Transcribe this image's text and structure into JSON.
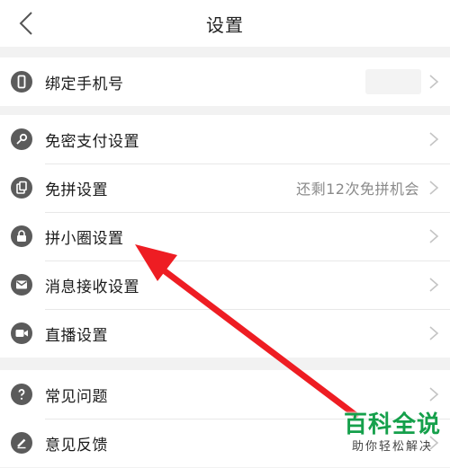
{
  "header": {
    "title": "设置"
  },
  "groups": [
    [
      {
        "label": "绑定手机号",
        "icon": "phone-icon"
      }
    ],
    [
      {
        "label": "免密支付设置",
        "icon": "key-icon"
      },
      {
        "label": "免拼设置",
        "icon": "coupon-icon",
        "value": "还剩12次免拼机会"
      },
      {
        "label": "拼小圈设置",
        "icon": "lock-icon"
      },
      {
        "label": "消息接收设置",
        "icon": "mail-icon"
      },
      {
        "label": "直播设置",
        "icon": "video-icon"
      }
    ],
    [
      {
        "label": "常见问题",
        "icon": "question-icon"
      },
      {
        "label": "意见反馈",
        "icon": "pencil-icon"
      }
    ]
  ],
  "watermark": {
    "brand": "百科全说",
    "slogan": "助你轻松解决"
  },
  "colors": {
    "arrow": "#ee1d23",
    "brand": "#15a04b",
    "icon": "#5b5b5b"
  }
}
